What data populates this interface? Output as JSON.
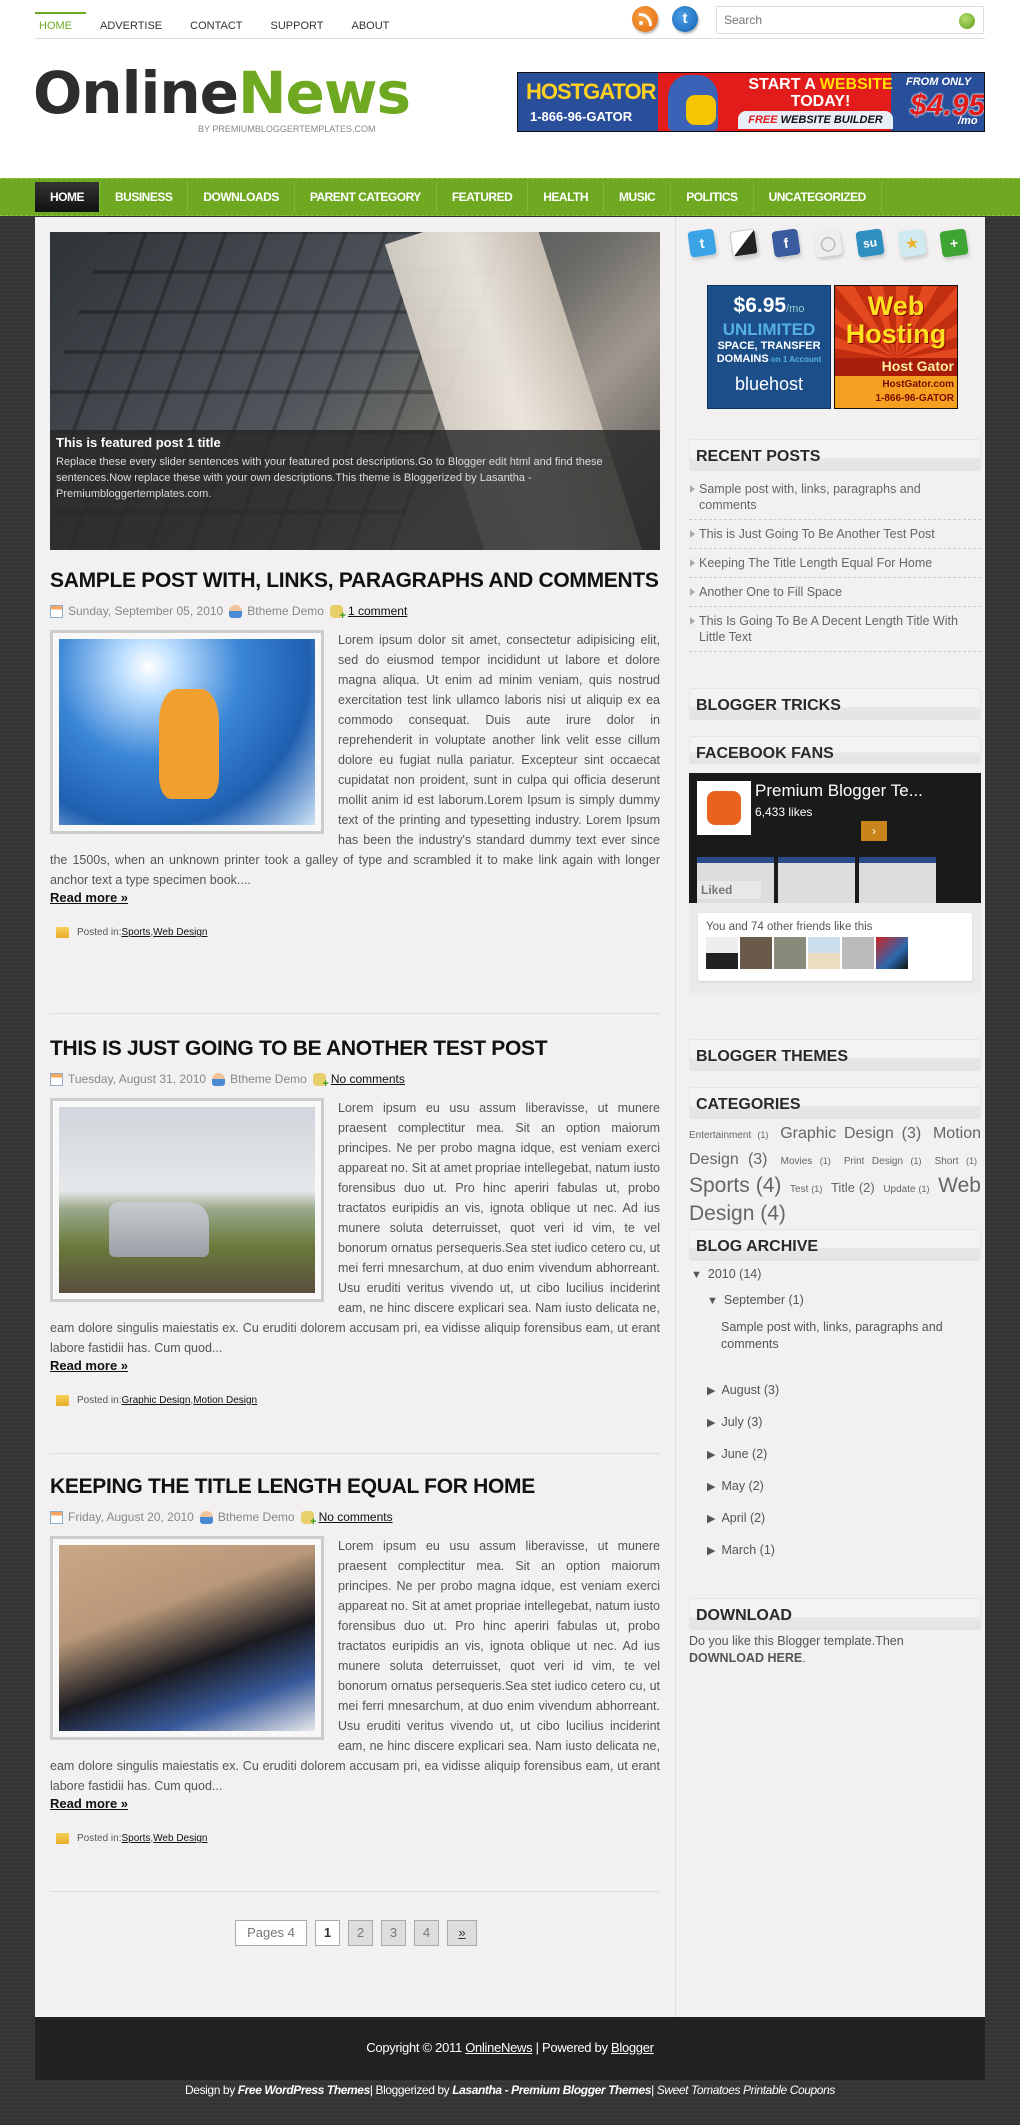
{
  "topnav": [
    "HOME",
    "ADVERTISE",
    "CONTACT",
    "SUPPORT",
    "ABOUT"
  ],
  "search": {
    "placeholder": "Search"
  },
  "social_top": [
    "rss-icon",
    "twitter-icon"
  ],
  "logo": {
    "part1": "Online",
    "part2": "News",
    "tagline": "BY PREMIUMBLOGGERTEMPLATES.COM"
  },
  "banner": {
    "brand": "HOSTGATOR",
    "phone": "1-866-96-GATOR",
    "line1a": "START A ",
    "line1b": "WEBSITE",
    "line2": "TODAY!",
    "free": "FREE",
    "builder": " WEBSITE BUILDER",
    "from": "FROM ONLY",
    "price": "$4.95",
    "per": "/mo"
  },
  "mainnav": [
    "HOME",
    "BUSINESS",
    "DOWNLOADS",
    "PARENT CATEGORY",
    "FEATURED",
    "HEALTH",
    "MUSIC",
    "POLITICS",
    "UNCATEGORIZED"
  ],
  "slider": {
    "title": "This is featured post 1 title",
    "desc": "Replace these every slider sentences with your featured post descriptions.Go to Blogger edit html and find these sentences.Now replace these with your own descriptions.This theme is Bloggerized by Lasantha - Premiumbloggertemplates.com."
  },
  "posts": [
    {
      "title": "SAMPLE POST WITH, LINKS, PARAGRAPHS AND COMMENTS",
      "date": "Sunday, September 05, 2010",
      "author": "Btheme Demo",
      "comments": "1 comment",
      "excerpt": "Lorem ipsum dolor sit amet, consectetur adipisicing elit, sed do eiusmod tempor incididunt ut labore et dolore magna aliqua. Ut enim ad minim veniam, quis nostrud exercitation test link ullamco laboris nisi ut aliquip ex ea commodo consequat. Duis aute irure dolor in reprehenderit in voluptate another link velit esse cillum dolore eu fugiat nulla pariatur. Excepteur sint occaecat cupidatat non proident, sunt in culpa qui officia deserunt mollit anim id est laborum.Lorem Ipsum is simply dummy text of the printing and typesetting industry. Lorem Ipsum has been the industry's standard dummy text ever since the 1500s, when an unknown printer took a galley of type and scrambled it to make link again with longer anchor text a type specimen book....",
      "readmore": "Read more »",
      "posted_in": "Posted in: ",
      "labels": [
        "Sports",
        "Web Design"
      ]
    },
    {
      "title": "THIS IS JUST GOING TO BE ANOTHER TEST POST",
      "date": "Tuesday, August 31, 2010",
      "author": "Btheme Demo",
      "comments": "No comments",
      "excerpt": "Lorem ipsum eu usu assum liberavisse, ut munere praesent complectitur mea. Sit an option maiorum principes. Ne per probo magna idque, est veniam exerci appareat no. Sit at amet propriae intellegebat, natum iusto forensibus duo ut. Pro hinc aperiri fabulas ut, probo tractatos euripidis an vis, ignota oblique ut nec. Ad ius munere soluta deterruisset, quot veri id vim, te vel bonorum ornatus persequeris.Sea stet iudico cetero cu, ut mei ferri mnesarchum, at duo enim vivendum abhorreant. Usu eruditi veritus vivendo ut, ut cibo lucilius inciderint eam, ne hinc discere explicari sea. Nam iusto delicata ne, eam dolore singulis maiestatis ex. Cu eruditi dolorem accusam pri, ea vidisse aliquip forensibus eam, ut erant labore fastidii has. Cum quod...",
      "readmore": "Read more »",
      "posted_in": "Posted in: ",
      "labels": [
        "Graphic Design",
        "Motion Design"
      ]
    },
    {
      "title": "KEEPING THE TITLE LENGTH EQUAL FOR HOME",
      "date": "Friday, August 20, 2010",
      "author": "Btheme Demo",
      "comments": "No comments",
      "excerpt": "Lorem ipsum eu usu assum liberavisse, ut munere praesent complectitur mea. Sit an option maiorum principes. Ne per probo magna idque, est veniam exerci appareat no. Sit at amet propriae intellegebat, natum iusto forensibus duo ut. Pro hinc aperiri fabulas ut, probo tractatos euripidis an vis, ignota oblique ut nec. Ad ius munere soluta deterruisset, quot veri id vim, te vel bonorum ornatus persequeris.Sea stet iudico cetero cu, ut mei ferri mnesarchum, at duo enim vivendum abhorreant. Usu eruditi veritus vivendo ut, ut cibo lucilius inciderint eam, ne hinc discere explicari sea. Nam iusto delicata ne, eam dolore singulis maiestatis ex. Cu eruditi dolorem accusam pri, ea vidisse aliquip forensibus eam, ut erant labore fastidii has. Cum quod...",
      "readmore": "Read more »",
      "posted_in": "Posted in: ",
      "labels": [
        "Sports",
        "Web Design"
      ]
    }
  ],
  "pager": {
    "label": "Pages 4",
    "current": "1",
    "pages": [
      "2",
      "3",
      "4"
    ],
    "next": "»"
  },
  "sidebar": {
    "share_icons": [
      "twitter-icon",
      "delicious-icon",
      "facebook-icon",
      "myspace-icon",
      "stumbleupon-icon",
      "favorite-icon",
      "addthis-icon"
    ],
    "ad_bluehost": {
      "price": "$6.95",
      "per": "/mo",
      "unlimited": "UNLIMITED",
      "line1": "SPACE, TRANSFER",
      "line2": "DOMAINS",
      "line2b": " on 1 Account",
      "brand": "bluehost"
    },
    "ad_hostgator": {
      "line1": "Web",
      "line2": "Hosting",
      "brand": "Host Gator",
      "site": "HostGator.com",
      "phone": "1-866-96-GATOR"
    },
    "recent_title": "RECENT POSTS",
    "recent": [
      "Sample post with, links, paragraphs and comments",
      "This is Just Going To Be Another Test Post",
      "Keeping The Title Length Equal For Home",
      "Another One to Fill Space",
      "This Is Going To Be A Decent Length Title With Little Text"
    ],
    "tricks_title": "BLOGGER TRICKS",
    "fb_title": "FACEBOOK FANS",
    "fb": {
      "page": "Premium Blogger Te...",
      "likes": "6,433 likes",
      "liked": "Liked",
      "friends": "You and 74 other friends like this"
    },
    "themes_title": "BLOGGER THEMES",
    "cats_title": "CATEGORIES",
    "categories": [
      {
        "name": "Entertainment",
        "count": "(1)",
        "size": 10
      },
      {
        "name": "Graphic Design",
        "count": "(3)",
        "size": 16
      },
      {
        "name": "Motion Design",
        "count": "(3)",
        "size": 16
      },
      {
        "name": "Movies",
        "count": "(1)",
        "size": 10
      },
      {
        "name": "Print Design",
        "count": "(1)",
        "size": 10
      },
      {
        "name": "Short",
        "count": "(1)",
        "size": 10
      },
      {
        "name": "Sports",
        "count": "(4)",
        "size": 21
      },
      {
        "name": "Test",
        "count": "(1)",
        "size": 10
      },
      {
        "name": "Title",
        "count": "(2)",
        "size": 13
      },
      {
        "name": "Update",
        "count": "(1)",
        "size": 10
      },
      {
        "name": "Web Design",
        "count": "(4)",
        "size": 21
      }
    ],
    "archive_title": "BLOG ARCHIVE",
    "archive": {
      "year": "2010 (14)",
      "open_month": "September (1)",
      "open_post": "Sample post with, links, paragraphs and comments",
      "months": [
        "August (3)",
        "July (3)",
        "June (2)",
        "May (2)",
        "April (2)",
        "March (1)"
      ]
    },
    "download_title": "DOWNLOAD",
    "download_text": "Do you like this Blogger template.Then ",
    "download_link": "DOWNLOAD HERE",
    "download_end": "."
  },
  "footer": {
    "copy": "Copyright © 2011 ",
    "site": "OnlineNews",
    "powered": " | Powered by ",
    "blogger": "Blogger"
  },
  "credits": {
    "design": "Design by ",
    "wp": "Free WordPress Themes",
    "bloggerized": "| Bloggerized by ",
    "lasantha": "Lasantha - Premium Blogger Themes",
    "sep": "| ",
    "coupons": "Sweet Tomatoes Printable Coupons"
  }
}
